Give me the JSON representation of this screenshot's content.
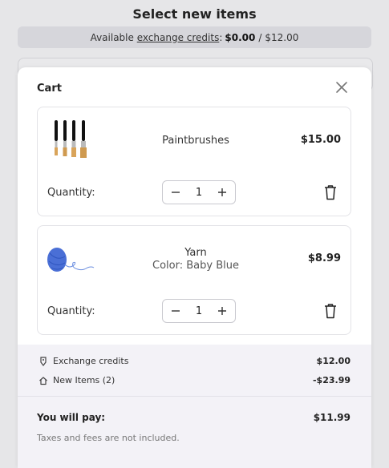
{
  "page": {
    "title": "Select new items"
  },
  "credits_bar": {
    "prefix": "Available",
    "link": "exchange credits",
    "colon": ":",
    "available": "$0.00",
    "separator": "/",
    "total": "$12.00"
  },
  "cart": {
    "title": "Cart",
    "items": [
      {
        "name": "Paintbrushes",
        "variant": "",
        "price": "$15.00",
        "quantity_label": "Quantity:",
        "quantity": "1",
        "thumb_icon": "paintbrushes-image"
      },
      {
        "name": "Yarn",
        "variant": "Color: Baby Blue",
        "price": "$8.99",
        "quantity_label": "Quantity:",
        "quantity": "1",
        "thumb_icon": "yarn-image"
      }
    ],
    "summary": {
      "credits_label": "Exchange credits",
      "credits_amount": "$12.00",
      "new_items_label": "New Items (2)",
      "new_items_amount": "-$23.99",
      "pay_label": "You will pay:",
      "pay_amount": "$11.99",
      "note": "Taxes and fees are not included."
    }
  },
  "colors": {
    "background": "#e6e6e8",
    "summary_bg": "#f3f2f7",
    "yarn": "#4a6fd6"
  }
}
